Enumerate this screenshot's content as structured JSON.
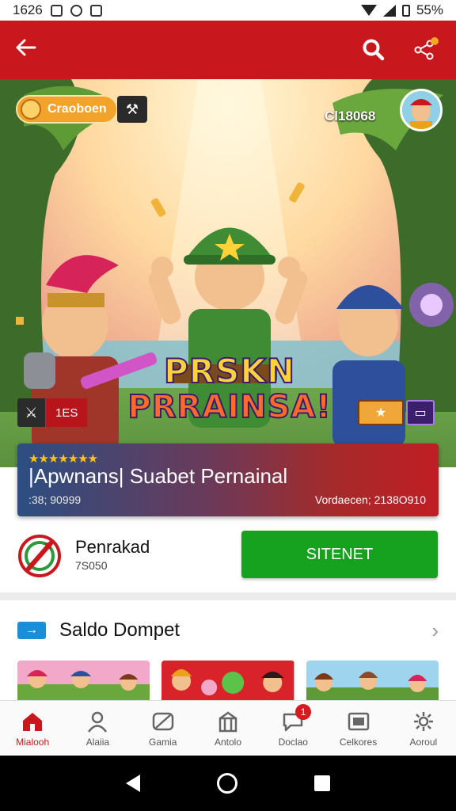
{
  "status_bar": {
    "time": "1626",
    "battery": "55%"
  },
  "app_bar": {
    "back_icon": "arrow-left-icon",
    "search_icon": "search-icon",
    "share_icon": "share-icon",
    "accent": "#c8171d"
  },
  "hero": {
    "top_chip": "Craoboen",
    "user_code": "Cl18068",
    "title_line1": "PRSKN",
    "title_line2": "PRRAINSA!",
    "badge_left": "1ES"
  },
  "banner": {
    "rating_stars": "★★★★★★★",
    "title": "|Apwnans| Suabet Pernainal",
    "left_meta": ":38; 90999",
    "right_meta": "Vordaecen; 2138O910"
  },
  "wallet": {
    "name": "Penrakad",
    "balance": "7S050",
    "button_label": "SITENET",
    "button_color": "#16a11f"
  },
  "section": {
    "title": "Saldo Dompet"
  },
  "bottom_nav": [
    {
      "label": "Mialooh",
      "icon": "home-icon",
      "active": true
    },
    {
      "label": "Alaiia",
      "icon": "profile-icon"
    },
    {
      "label": "Gamia",
      "icon": "game-icon"
    },
    {
      "label": "Antolo",
      "icon": "gift-icon"
    },
    {
      "label": "Doclao",
      "icon": "chat-icon",
      "badge": "1"
    },
    {
      "label": "Celkores",
      "icon": "folder-icon"
    },
    {
      "label": "Aoroul",
      "icon": "gear-icon"
    }
  ]
}
